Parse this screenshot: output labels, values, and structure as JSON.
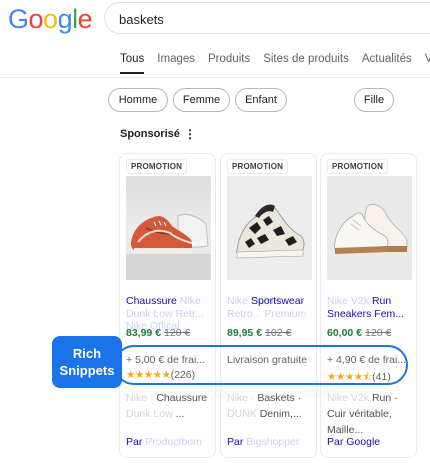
{
  "header": {
    "logo": [
      "G",
      "o",
      "o",
      "g",
      "l",
      "e"
    ],
    "logo_colors": [
      "#4285f4",
      "#ea4335",
      "#fbbc05",
      "#4285f4",
      "#34a853",
      "#ea4335"
    ],
    "search_value": "baskets"
  },
  "tabs": [
    {
      "label": "Tous",
      "active": true
    },
    {
      "label": "Images"
    },
    {
      "label": "Produits"
    },
    {
      "label": "Sites de produits"
    },
    {
      "label": "Actualités"
    },
    {
      "label": "V"
    }
  ],
  "chips": [
    "Homme",
    "Femme",
    "Enfant",
    "Fille"
  ],
  "sponsored": {
    "label": "Sponsorisé",
    "menu_icon": "⋮"
  },
  "products": [
    {
      "badge": "PROMOTION",
      "title": "Chaussure",
      "title_blurred": "Nike Dunk Low Retr... Nike Offical",
      "price": "83,99 €",
      "old_price": "120 €",
      "delivery": "+ 5,00 € de frai...",
      "stars": "★★★★★",
      "reviews": "(226)",
      "desc_blurred_1": "Nike ·",
      "desc_1": "Chaussure",
      "desc_blurred_2": "· Dunk Low",
      "desc_2": "...",
      "seller_prefix": "Par",
      "seller_blurred": "Productbom",
      "seller_name": ""
    },
    {
      "badge": "PROMOTION",
      "title": "Sportswear",
      "title_blurred": "Nike DUNK Retro... Premium",
      "price": "89,95 €",
      "old_price": "102 €",
      "delivery": "Livraison gratuite",
      "stars": "",
      "reviews": "",
      "desc_blurred_1": "Nike ·",
      "desc_1": "Baskets ·",
      "desc_blurred_2": "DUNK",
      "desc_2": "Denim,...",
      "seller_prefix": "Par",
      "seller_blurred": "Bigshopper",
      "seller_name": ""
    },
    {
      "badge": "PROMOTION",
      "title": "Run Sneakers Fem...",
      "title_blurred": "Nike V2k",
      "price": "60,00 €",
      "old_price": "120 €",
      "delivery": "+ 4,90 € de frai...",
      "stars": "★★★★⯪",
      "reviews": "(41)",
      "desc_blurred_1": "Nike V2k",
      "desc_1": "Run · Cuir",
      "desc_blurred_2": "",
      "desc_2": "véritable, Maille...",
      "seller_prefix": "Par",
      "seller_blurred": "",
      "seller_name": "Google"
    }
  ],
  "annotation": {
    "label_line1": "Rich",
    "label_line2": "Snippets",
    "color": "#1a73e8"
  }
}
